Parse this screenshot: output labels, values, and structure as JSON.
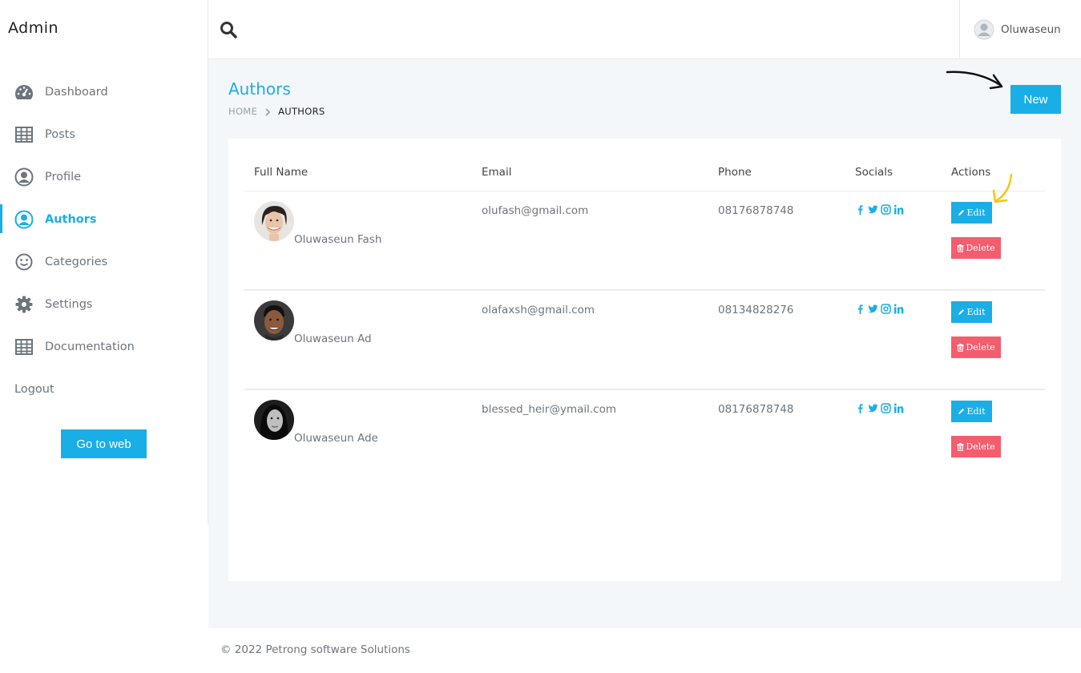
{
  "sidebar": {
    "brand": "Admin",
    "items": [
      {
        "label": "Dashboard",
        "icon": "dashboard-icon"
      },
      {
        "label": "Posts",
        "icon": "table-icon"
      },
      {
        "label": "Profile",
        "icon": "user-circle-icon"
      },
      {
        "label": "Authors",
        "icon": "user-circle-icon",
        "active": true
      },
      {
        "label": "Categories",
        "icon": "smile-icon"
      },
      {
        "label": "Settings",
        "icon": "gear-icon"
      },
      {
        "label": "Documentation",
        "icon": "table-icon"
      }
    ],
    "logout": "Logout",
    "go_to_web": "Go to web"
  },
  "topbar": {
    "search_icon": "search-icon",
    "user_name": "Oluwaseun"
  },
  "page": {
    "title": "Authors",
    "breadcrumb": {
      "home": "HOME",
      "current": "AUTHORS"
    },
    "new_button": "New"
  },
  "table": {
    "headers": [
      "Full Name",
      "Email",
      "Phone",
      "Socials",
      "Actions"
    ],
    "rows": [
      {
        "name": "Oluwaseun Fash",
        "email": "olufash@gmail.com",
        "phone": "08176878748"
      },
      {
        "name": "Oluwaseun Ad",
        "email": "olafaxsh@gmail.com",
        "phone": "08134828276"
      },
      {
        "name": "Oluwaseun Ade",
        "email": "blessed_heir@ymail.com",
        "phone": "08176878748"
      }
    ],
    "edit_label": "Edit",
    "delete_label": "Delete"
  },
  "footer": "© 2022 Petrong software Solutions",
  "colors": {
    "accent": "#1aaee6",
    "danger": "#f35d6e",
    "background": "#f4f7f9"
  }
}
